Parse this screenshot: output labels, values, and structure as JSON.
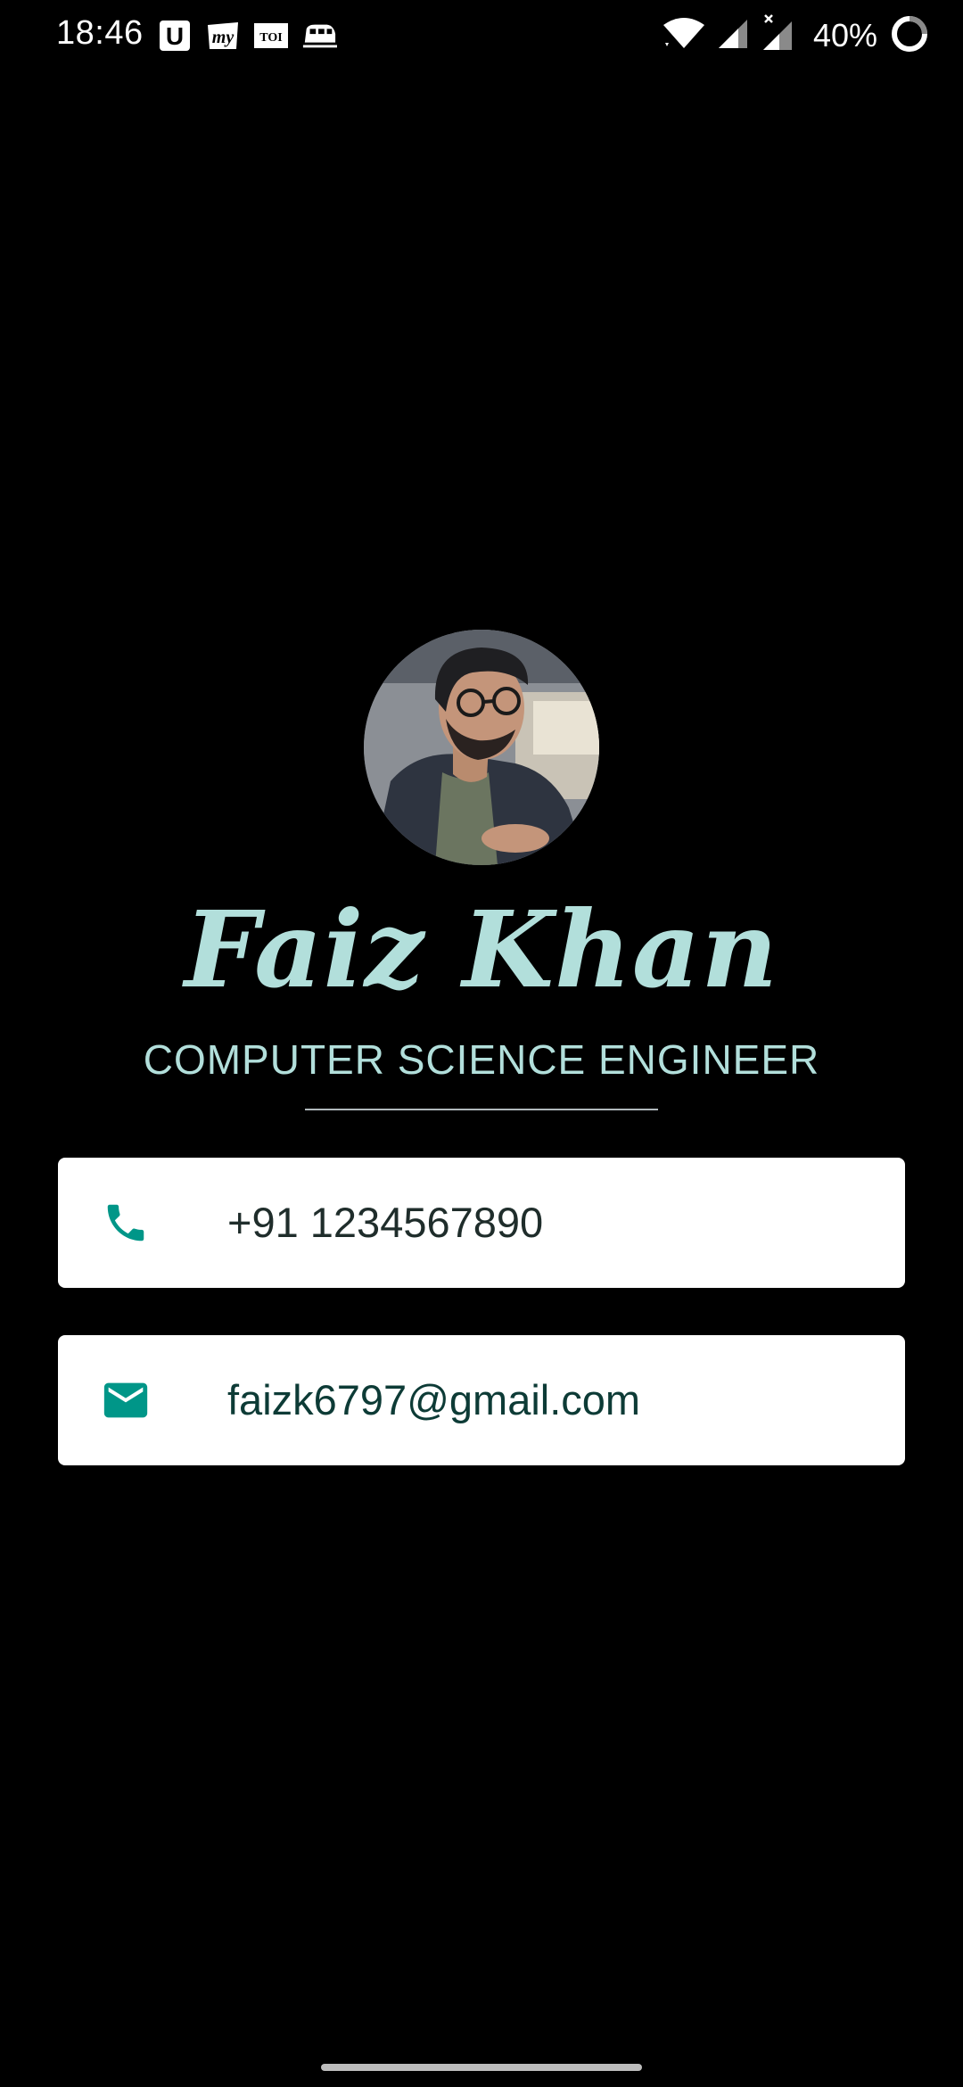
{
  "status_bar": {
    "time": "18:46",
    "battery_percent": "40%",
    "notification_icons": [
      "u-app-icon",
      "myntra-icon",
      "toi-icon",
      "train-icon"
    ],
    "system_icons": [
      "wifi-icon",
      "signal-icon",
      "signal-no-data-icon",
      "battery-icon"
    ]
  },
  "profile": {
    "name": "Faiz Khan",
    "title": "COMPUTER SCIENCE ENGINEER",
    "avatar_alt": "profile photo"
  },
  "contacts": {
    "phone": {
      "icon": "phone-icon",
      "value": "+91 1234567890"
    },
    "email": {
      "icon": "mail-icon",
      "value": "faizk6797@gmail.com"
    }
  },
  "colors": {
    "background": "#000000",
    "accent_text": "#b2dfdb",
    "icon_teal": "#009688",
    "card_bg": "#ffffff"
  },
  "notif_labels": {
    "u": "U",
    "my": "my",
    "toi": "TOI"
  }
}
